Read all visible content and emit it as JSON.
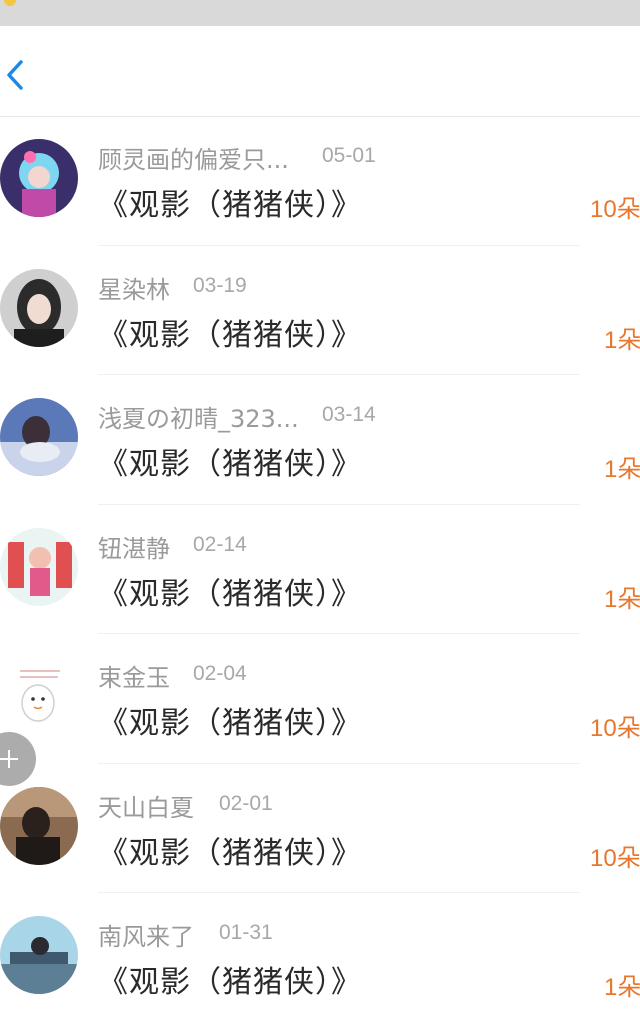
{
  "colors": {
    "accent_blue": "#1e88e5",
    "flower_orange": "#e8772e",
    "username_gray": "#9a9a9a",
    "title_dark": "#2a2a2a"
  },
  "nav": {
    "back_icon": "chevron-left-icon"
  },
  "items": [
    {
      "username": "顾灵画的偏爱只...",
      "date": "05-01",
      "title": "《观影（猪猪侠）》",
      "flowers": "10朵"
    },
    {
      "username": "星染林",
      "date": "03-19",
      "title": "《观影（猪猪侠）》",
      "flowers": "1朵"
    },
    {
      "username": "浅夏の初晴_323...",
      "date": "03-14",
      "title": "《观影（猪猪侠）》",
      "flowers": "1朵"
    },
    {
      "username": "钮湛静",
      "date": "02-14",
      "title": "《观影（猪猪侠）》",
      "flowers": "1朵"
    },
    {
      "username": "束金玉",
      "date": "02-04",
      "title": "《观影（猪猪侠）》",
      "flowers": "10朵"
    },
    {
      "username": "天山白夏",
      "date": "02-01",
      "title": "《观影（猪猪侠）》",
      "flowers": "10朵"
    },
    {
      "username": "南风来了",
      "date": "01-31",
      "title": "《观影（猪猪侠）》",
      "flowers": "1朵"
    }
  ],
  "fab": {
    "icon": "plus-icon"
  }
}
